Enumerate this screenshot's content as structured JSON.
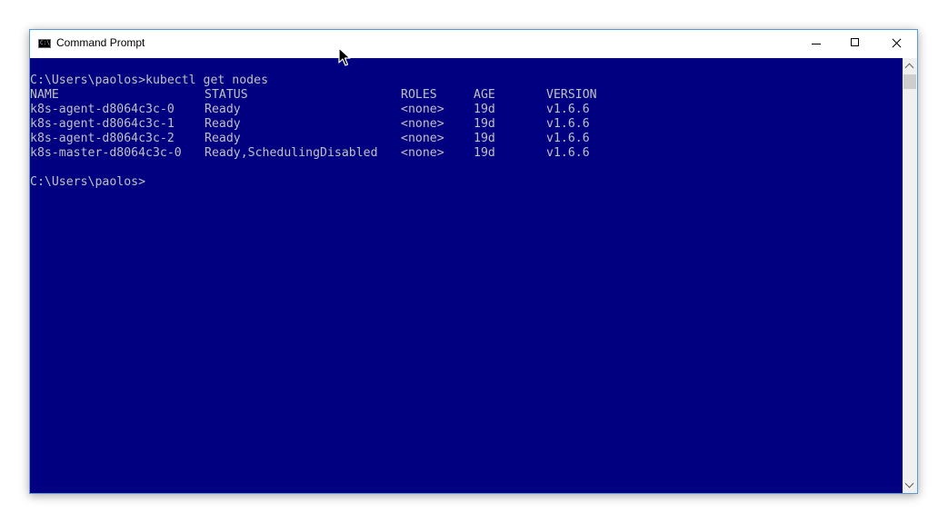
{
  "window": {
    "title": "Command Prompt",
    "icon": "cmd-icon",
    "icon_text": "C:\\",
    "controls": [
      "minimize-icon",
      "maximize-icon",
      "close-icon"
    ]
  },
  "console": {
    "background": "#000080",
    "foreground": "#c0c0c0",
    "command_line": "C:\\Users\\paolos>kubectl get nodes",
    "table": {
      "headers": {
        "name": "NAME",
        "status": "STATUS",
        "roles": "ROLES",
        "age": "AGE",
        "version": "VERSION"
      },
      "rows": [
        {
          "name": "k8s-agent-d8064c3c-0",
          "status": "Ready",
          "roles": "<none>",
          "age": "19d",
          "version": "v1.6.6"
        },
        {
          "name": "k8s-agent-d8064c3c-1",
          "status": "Ready",
          "roles": "<none>",
          "age": "19d",
          "version": "v1.6.6"
        },
        {
          "name": "k8s-agent-d8064c3c-2",
          "status": "Ready",
          "roles": "<none>",
          "age": "19d",
          "version": "v1.6.6"
        },
        {
          "name": "k8s-master-d8064c3c-0",
          "status": "Ready,SchedulingDisabled",
          "roles": "<none>",
          "age": "19d",
          "version": "v1.6.6"
        }
      ]
    },
    "prompt": "C:\\Users\\paolos>"
  },
  "scrollbar": {
    "up_icon": "chevron-up-icon",
    "down_icon": "chevron-down-icon"
  },
  "mouse_cursor_icon": "arrow-cursor-icon"
}
